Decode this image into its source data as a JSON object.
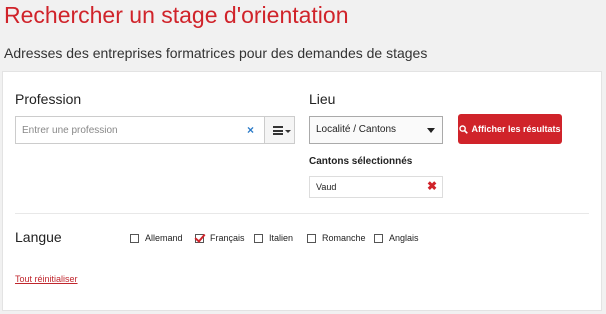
{
  "header": {
    "title": "Rechercher un stage d'orientation",
    "subtitle": "Adresses des entreprises formatrices pour des demandes de stages"
  },
  "profession": {
    "label": "Profession",
    "placeholder": "Entrer une profession",
    "value": "",
    "clear_icon": "×",
    "list_icon": "list-icon"
  },
  "lieu": {
    "label": "Lieu",
    "selected": "Localité / Cantons"
  },
  "search_button": {
    "label": "Afficher les résultats",
    "icon": "search-icon"
  },
  "cantons": {
    "heading": "Cantons sélectionnés",
    "items": [
      {
        "name": "Vaud",
        "remove_icon": "✖"
      }
    ]
  },
  "langue": {
    "label": "Langue",
    "options": [
      {
        "label": "Allemand",
        "checked": false
      },
      {
        "label": "Français",
        "checked": true
      },
      {
        "label": "Italien",
        "checked": false
      },
      {
        "label": "Romanche",
        "checked": false
      },
      {
        "label": "Anglais",
        "checked": false
      }
    ]
  },
  "reset_link": "Tout réinitialiser",
  "colors": {
    "accent": "#d0232a",
    "background": "#f1f1f1",
    "panel": "#ffffff"
  }
}
